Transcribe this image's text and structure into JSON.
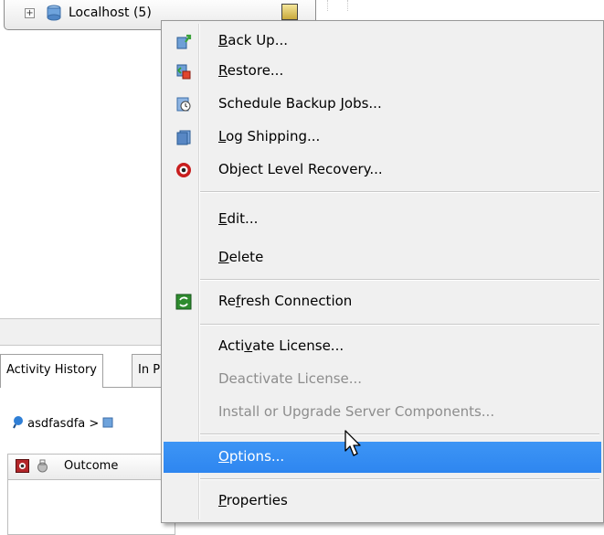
{
  "tree": {
    "server_label": "Localhost (5)",
    "expand_glyph": "+"
  },
  "bottom_panel": {
    "tabs": [
      "Activity History",
      "In P"
    ],
    "breadcrumb": {
      "root": "asdfasdfa",
      "separator": ">"
    },
    "grid_columns": [
      "Outcome"
    ]
  },
  "menu": {
    "items": [
      {
        "pre": "",
        "key": "B",
        "post": "ack Up...",
        "icon": "backup-icon"
      },
      {
        "pre": "",
        "key": "R",
        "post": "estore...",
        "icon": "restore-icon"
      },
      {
        "pre": "Schedule Backup ",
        "key": "J",
        "post": "obs...",
        "icon": "schedule-icon"
      },
      {
        "pre": "",
        "key": "L",
        "post": "og Shipping...",
        "icon": "log-shipping-icon"
      },
      {
        "pre": "Object Level Recovery...",
        "key": "",
        "post": "",
        "icon": "object-recovery-icon"
      },
      {
        "pre": "",
        "key": "E",
        "post": "dit...",
        "icon": ""
      },
      {
        "pre": "",
        "key": "D",
        "post": "elete",
        "icon": ""
      },
      {
        "pre": "Re",
        "key": "f",
        "post": "resh Connection",
        "icon": "refresh-icon"
      },
      {
        "pre": "Acti",
        "key": "v",
        "post": "ate License...",
        "icon": ""
      },
      {
        "pre": "Deactivate License...",
        "key": "",
        "post": "",
        "icon": ""
      },
      {
        "pre": "Install or Upgrade Server Components...",
        "key": "",
        "post": "",
        "icon": ""
      },
      {
        "pre": "",
        "key": "O",
        "post": "ptions...",
        "icon": ""
      },
      {
        "pre": "",
        "key": "P",
        "post": "roperties",
        "icon": ""
      }
    ]
  },
  "colors": {
    "highlight": "#3391f3",
    "menu_bg": "#f0f0f0",
    "disabled_text": "#8d8d8d"
  }
}
